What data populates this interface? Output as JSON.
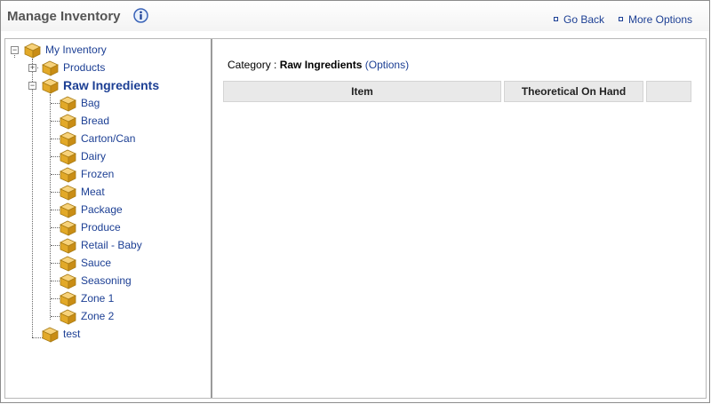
{
  "header": {
    "title": "Manage Inventory",
    "info_icon": "info-icon",
    "links": {
      "go_back": "Go Back",
      "more_options": "More Options"
    }
  },
  "tree": {
    "root": "My Inventory",
    "products": "Products",
    "raw_ingredients": "Raw Ingredients",
    "children": [
      "Bag",
      "Bread",
      "Carton/Can",
      "Dairy",
      "Frozen",
      "Meat",
      "Package",
      "Produce",
      "Retail - Baby",
      "Sauce",
      "Seasoning",
      "Zone 1",
      "Zone 2"
    ],
    "test": "test",
    "node_icon": "box-icon"
  },
  "main": {
    "category_label": "Category : ",
    "category_value": "Raw Ingredients",
    "category_options": "(Options)",
    "columns": [
      "Item",
      "Theoretical On Hand",
      ""
    ]
  },
  "colors": {
    "link": "#1c3f94",
    "header_bg": "#e9e9e9"
  }
}
